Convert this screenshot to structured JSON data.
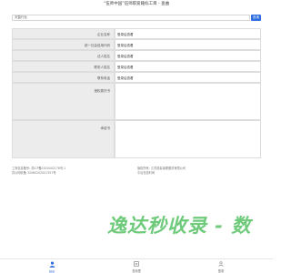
{
  "header": {
    "title": "“伍师中国”伍师职爱籍标工目 - 查曲"
  },
  "search": {
    "value": "天智行业",
    "button_label": "查询"
  },
  "info": {
    "rows": [
      {
        "label": "企业名称",
        "value": "登录后查看"
      },
      {
        "label": "统一社会信用代码",
        "value": "登录后查看"
      },
      {
        "label": "法人姓名",
        "value": "登录后查看"
      },
      {
        "label": "联系人姓名",
        "value": "登录后查看"
      },
      {
        "label": "联系电话",
        "value": "登录后查看"
      },
      {
        "label": "授权委托书",
        "value": ""
      },
      {
        "label": "承诺书",
        "value": ""
      }
    ]
  },
  "footer": {
    "left_line1": "工商信息备号: 苏ICP备2020402178号-1",
    "left_line2": "苏公网安备 32060202001357号",
    "right_line1": "版权所有: 江苏现善锦理服务有限公司",
    "right_line2": "平台在线时间"
  },
  "watermark": {
    "text": "逸达秒收录 - 数"
  },
  "bottom_nav": {
    "items": [
      {
        "label": "首页",
        "icon": "person-icon"
      },
      {
        "label": "查询里",
        "icon": "search-icon"
      },
      {
        "label": "登录",
        "icon": "login-icon"
      }
    ]
  },
  "colors": {
    "accent": "#2f6fe0",
    "watermark": "#6fca7b",
    "label_bg": "#ececec"
  }
}
